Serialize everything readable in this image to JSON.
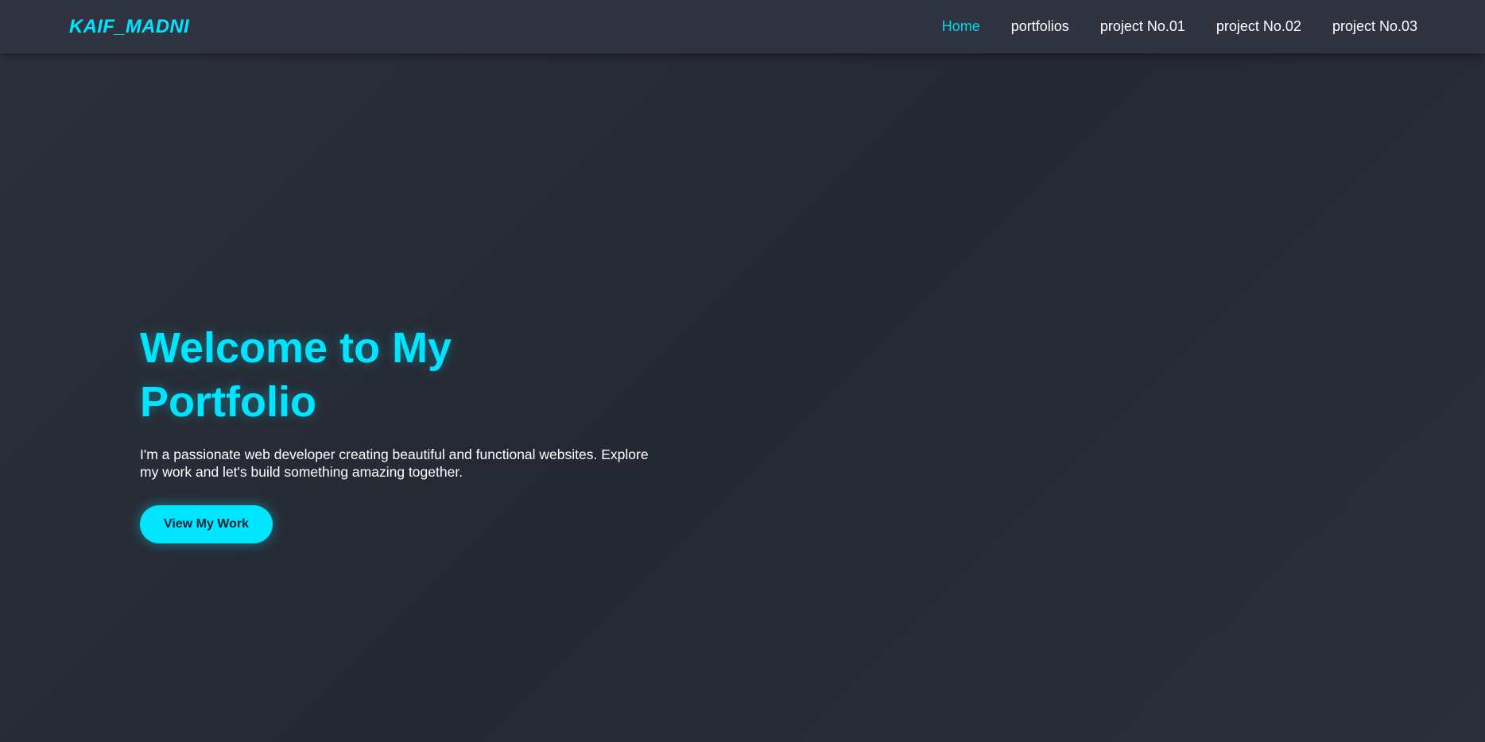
{
  "header": {
    "logo": "KAIF_MADNI",
    "nav": [
      {
        "label": "Home",
        "active": true
      },
      {
        "label": "portfolios",
        "active": false
      },
      {
        "label": "project No.01",
        "active": false
      },
      {
        "label": "project No.02",
        "active": false
      },
      {
        "label": "project No.03",
        "active": false
      }
    ]
  },
  "hero": {
    "title": "Welcome to My Portfolio",
    "description": "I'm a passionate web developer creating beautiful and functional websites. Explore my work and let's build something amazing together.",
    "button_label": "View My Work"
  },
  "colors": {
    "accent": "#00e5ff",
    "background": "#262a34",
    "navbar": "#2f3440",
    "text": "#ffffff"
  }
}
